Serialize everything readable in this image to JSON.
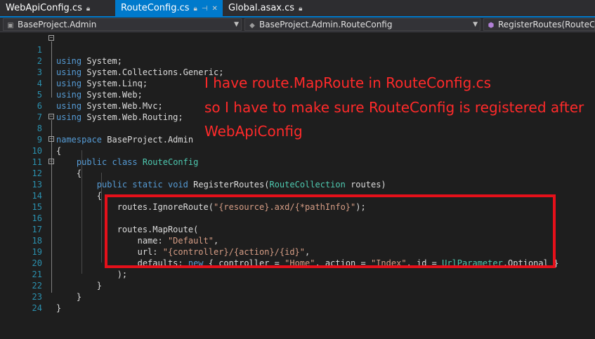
{
  "tabs": [
    {
      "label": "WebApiConfig.cs",
      "active": false,
      "pin": "pin-icon"
    },
    {
      "label": "RouteConfig.cs",
      "active": true,
      "pin": "pin-icon"
    },
    {
      "label": "Global.asax.cs",
      "active": false,
      "pin": "pin-icon"
    }
  ],
  "nav": {
    "project": "BaseProject.Admin",
    "class": "BaseProject.Admin.RouteConfig",
    "member": "RegisterRoutes(RouteCollection routes)"
  },
  "annotation": {
    "line1": "I have route.MapRoute in RouteConfig.cs",
    "line2": "so I have to make sure RouteConfig is registered after",
    "line3": "WebApiConfig",
    "color": "#ff2a2a"
  },
  "code": {
    "l1": [
      "1",
      "using",
      " System;"
    ],
    "l2": [
      "2",
      "using",
      " System.Collections.Generic;"
    ],
    "l3": [
      "3",
      "using",
      " System.Linq;"
    ],
    "l4": [
      "4",
      "using",
      " System.Web;"
    ],
    "l5": [
      "5",
      "using",
      " System.Web.Mvc;"
    ],
    "l6": [
      "6",
      "using",
      " System.Web.Routing;"
    ],
    "l7": [
      "7"
    ],
    "l8": [
      "8",
      "namespace",
      " BaseProject.Admin"
    ],
    "l9": [
      "9",
      "{"
    ],
    "l10": [
      "10",
      "    ",
      "public",
      " ",
      "class",
      " ",
      "RouteConfig"
    ],
    "l11": [
      "11",
      "    {"
    ],
    "l12": [
      "12",
      "        ",
      "public",
      " ",
      "static",
      " ",
      "void",
      " RegisterRoutes(",
      "RouteCollection",
      " routes)"
    ],
    "l13": [
      "13",
      "        {"
    ],
    "l14": [
      "14",
      "            routes.IgnoreRoute(",
      "\"{resource}.axd/{*pathInfo}\"",
      ");"
    ],
    "l15": [
      "15"
    ],
    "l16": [
      "16",
      "            routes.MapRoute("
    ],
    "l17": [
      "17",
      "                name: ",
      "\"Default\"",
      ","
    ],
    "l18": [
      "18",
      "                url: ",
      "\"{controller}/{action}/{id}\"",
      ","
    ],
    "l19": [
      "19",
      "                defaults: ",
      "new",
      " { controller = ",
      "\"Home\"",
      ", action = ",
      "\"Index\"",
      ", id = ",
      "UrlParameter",
      ".Optional }"
    ],
    "l20": [
      "20",
      "            );"
    ],
    "l21": [
      "21",
      "        }"
    ],
    "l22": [
      "22",
      "    }"
    ],
    "l23": [
      "23",
      "}"
    ],
    "l24": [
      "24"
    ]
  }
}
